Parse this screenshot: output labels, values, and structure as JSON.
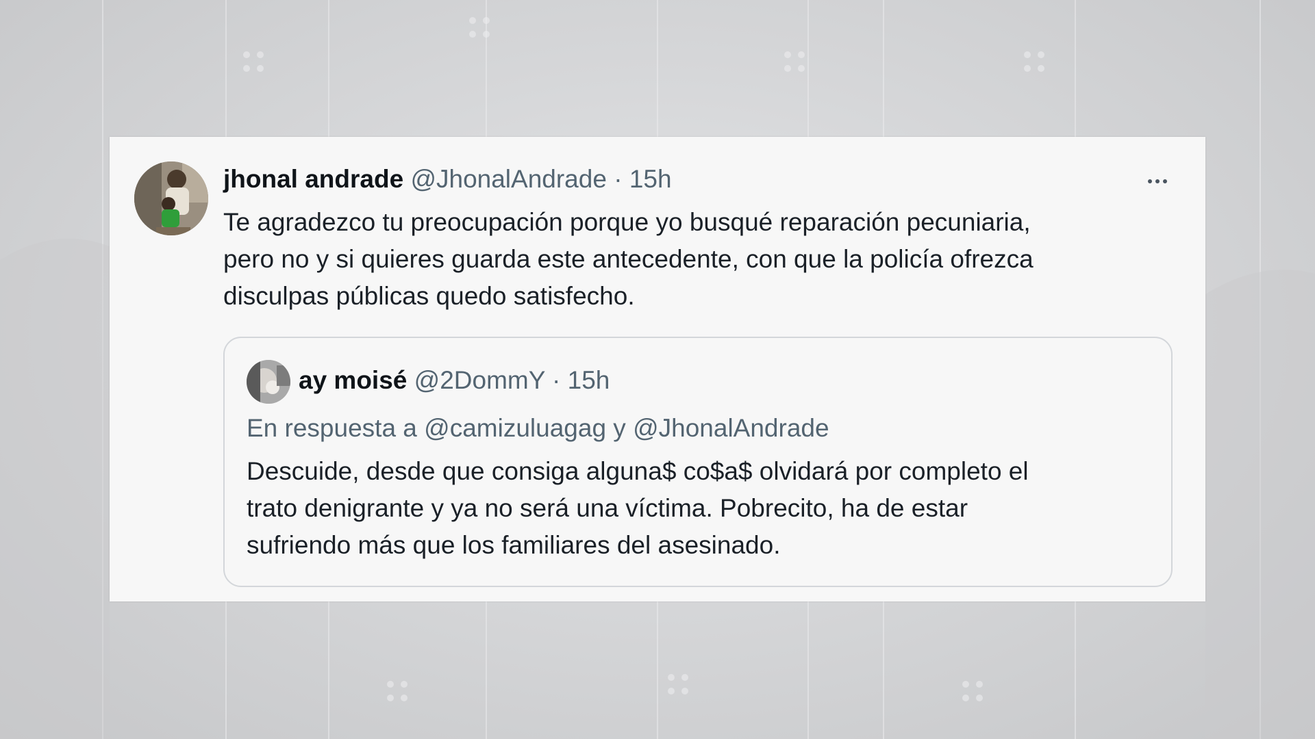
{
  "tweet": {
    "author_name": "jhonal andrade",
    "author_handle": "@JhonalAndrade",
    "separator": "·",
    "time": "15h",
    "text": "Te agradezco tu preocupación porque yo busqué reparación pecuniaria,\npero no y si quieres guarda este antecedente, con que la policía ofrezca\ndisculpas públicas quedo satisfecho.",
    "more_icon": "more-horizontal-icon"
  },
  "quoted": {
    "author_name": "ay moisé",
    "author_handle": "@2DommY",
    "separator": "·",
    "time": "15h",
    "reply_context": "En respuesta a @camizuluagag y @JhonalAndrade",
    "text": "Descuide, desde que consiga alguna$ co$a$ olvidará por completo el\ntrato denigrante y ya no será una víctima. Pobrecito, ha de estar\nsufriendo más que los familiares del asesinado."
  },
  "colors": {
    "card_background": "#f7f7f7",
    "primary_text": "#0f1419",
    "secondary_text": "#536471",
    "quote_border": "#d3d6da"
  }
}
